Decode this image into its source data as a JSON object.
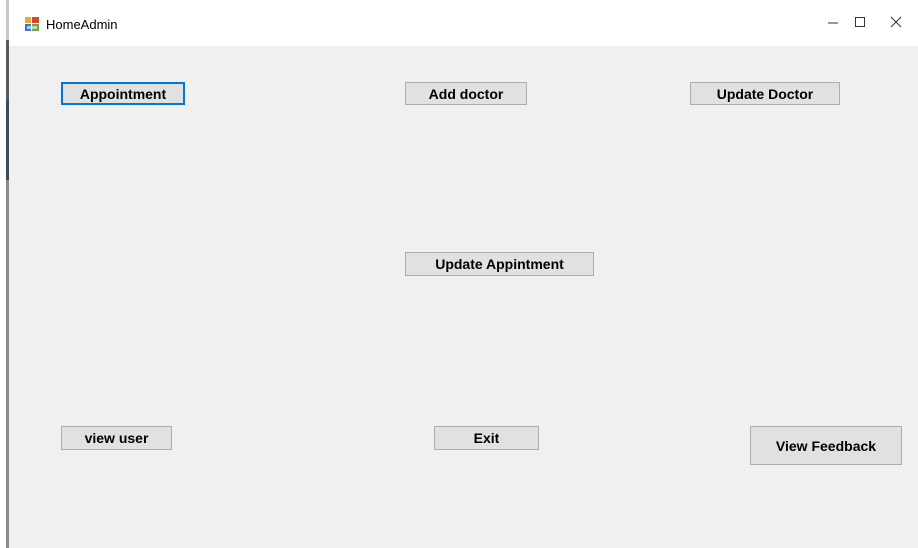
{
  "window": {
    "title": "HomeAdmin",
    "icons": {
      "app": "app-form-icon",
      "minimize": "minimize-icon",
      "maximize": "maximize-icon",
      "close": "close-icon"
    }
  },
  "buttons": {
    "appointment": "Appointment",
    "add_doctor": "Add doctor",
    "update_doctor": "Update Doctor",
    "update_appointment": "Update Appintment",
    "view_user": "view user",
    "exit": "Exit",
    "view_feedback": "View Feedback"
  },
  "colors": {
    "button_face": "#e1e1e1",
    "button_border": "#adadad",
    "focus_border": "#0078d7",
    "client_background": "#f0f0f0"
  }
}
